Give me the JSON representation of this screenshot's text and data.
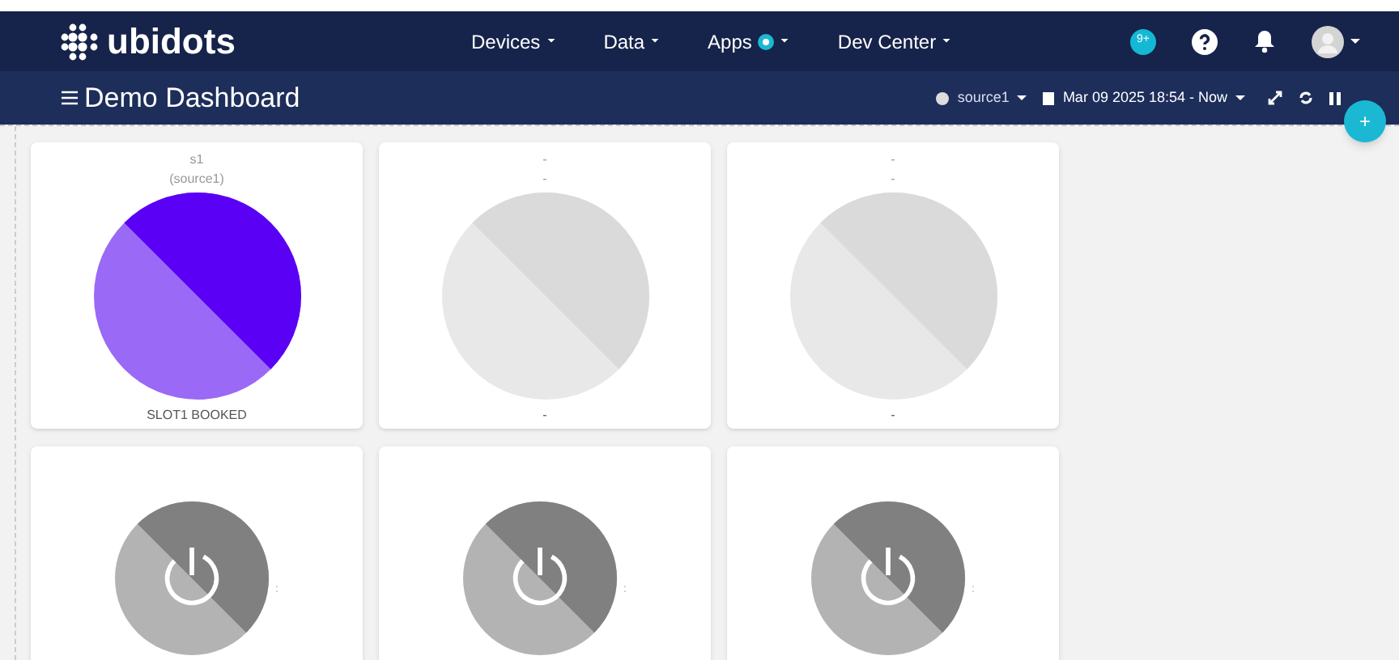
{
  "navbar": {
    "logo": "ubidots",
    "menu": [
      {
        "label": "Devices",
        "badge": false
      },
      {
        "label": "Data",
        "badge": false
      },
      {
        "label": "Apps",
        "badge": true
      },
      {
        "label": "Dev Center",
        "badge": false
      }
    ],
    "notifications": "9+"
  },
  "toolbar": {
    "title": "Demo Dashboard",
    "device": "source1",
    "date_range": "Mar 09 2025 18:54 - Now",
    "add_button": "+"
  },
  "widgets": [
    {
      "kind": "indicator",
      "title": "s1",
      "subtitle": "(source1)",
      "label": "SLOT1 BOOKED",
      "active": true
    },
    {
      "kind": "indicator",
      "title": "-",
      "subtitle": "-",
      "label": "-",
      "active": false
    },
    {
      "kind": "indicator",
      "title": "-",
      "subtitle": "-",
      "label": "-",
      "active": false
    },
    {
      "kind": "switch",
      "side_text": ":",
      "on": false
    },
    {
      "kind": "switch",
      "side_text": ":",
      "on": false
    },
    {
      "kind": "switch",
      "side_text": ":",
      "on": false
    }
  ]
}
